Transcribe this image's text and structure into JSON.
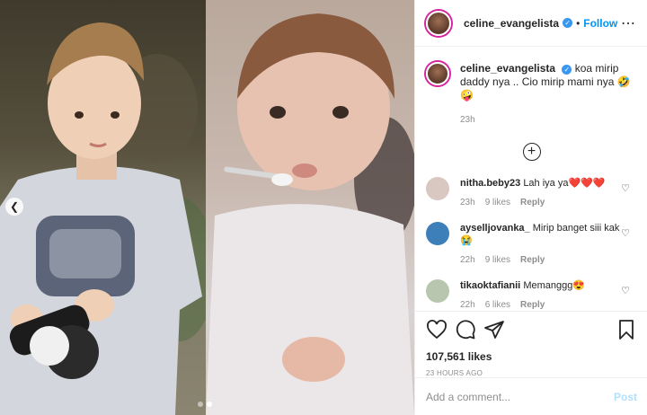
{
  "post": {
    "username": "celine_evangelista",
    "follow_label": "Follow",
    "separator": "•",
    "more_icon": "more-horizontal-icon"
  },
  "caption": {
    "username": "celine_evangelista",
    "text": "koa mirip daddy nya .. Cio mirip mami nya 🤣🤪",
    "age": "23h"
  },
  "comments": [
    {
      "username": "nitha.beby23",
      "text": "Lah iya ya❤️❤️❤️",
      "age": "23h",
      "likes": "9 likes",
      "reply": "Reply",
      "avatar_color": "#d9c7c2"
    },
    {
      "username": "ayselljovanka_",
      "text": "Mirip banget siii kak😭",
      "age": "22h",
      "likes": "9 likes",
      "reply": "Reply",
      "avatar_color": "#3d7fb8"
    },
    {
      "username": "tikaoktafianii",
      "text": "Memanggg😍",
      "age": "22h",
      "likes": "6 likes",
      "reply": "Reply",
      "avatar_color": "#b8c6b0"
    }
  ],
  "actions": {
    "likes": "107,561 likes",
    "timestamp": "23 HOURS AGO"
  },
  "add_comment": {
    "placeholder": "Add a comment...",
    "post_label": "Post"
  },
  "carousel": {
    "prev_icon": "chevron-left-icon",
    "active_index": 1,
    "count": 2
  },
  "colors": {
    "accent": "#0095f6",
    "verified": "#3897f0",
    "muted": "#8e8e8e",
    "post_disabled": "#b2dffc"
  }
}
